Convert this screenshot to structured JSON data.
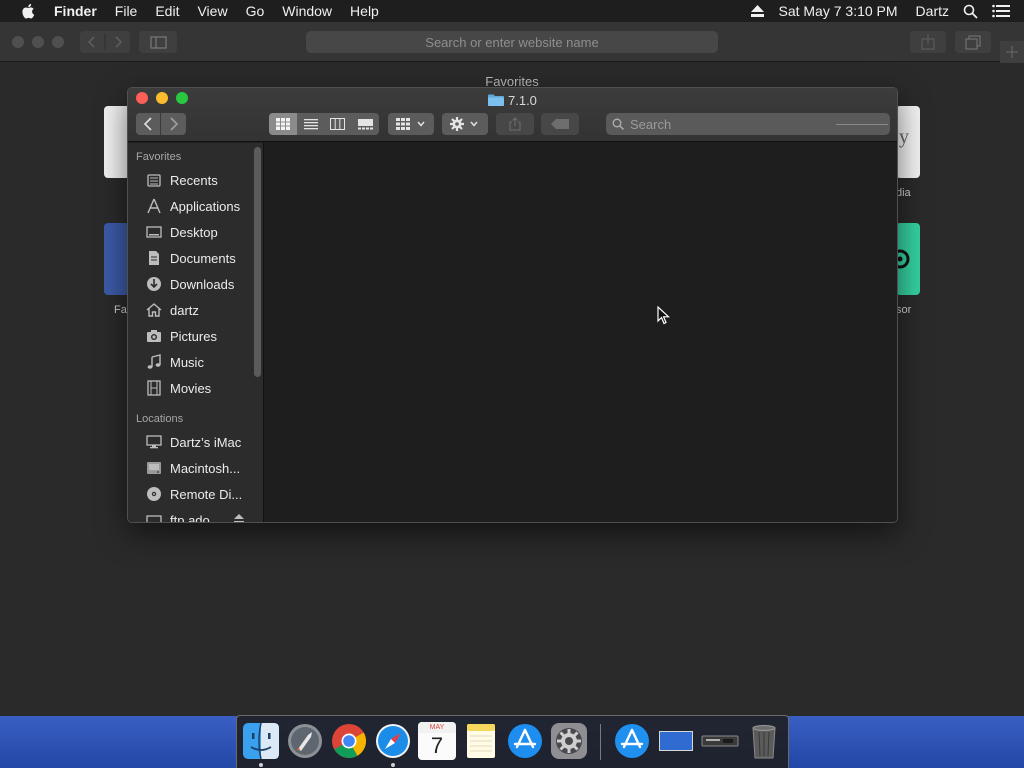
{
  "menubar": {
    "app_name": "Finder",
    "items": [
      "File",
      "Edit",
      "View",
      "Go",
      "Window",
      "Help"
    ],
    "datetime": "Sat May 7  3:10 PM",
    "user": "Dartz"
  },
  "safari": {
    "address_placeholder": "Search or enter website name",
    "favorites_heading": "Favorites",
    "partial_labels": {
      "left_bottom": "Fa",
      "right_top": "dia",
      "right_bottom": "sor"
    }
  },
  "finder": {
    "window_title": "7.1.0",
    "search_placeholder": "Search",
    "sidebar": {
      "favorites_heading": "Favorites",
      "favorites": [
        {
          "label": "Recents",
          "icon": "recents-icon"
        },
        {
          "label": "Applications",
          "icon": "applications-icon"
        },
        {
          "label": "Desktop",
          "icon": "desktop-icon"
        },
        {
          "label": "Documents",
          "icon": "documents-icon"
        },
        {
          "label": "Downloads",
          "icon": "downloads-icon"
        },
        {
          "label": "dartz",
          "icon": "home-icon"
        },
        {
          "label": "Pictures",
          "icon": "pictures-icon"
        },
        {
          "label": "Music",
          "icon": "music-icon"
        },
        {
          "label": "Movies",
          "icon": "movies-icon"
        }
      ],
      "locations_heading": "Locations",
      "locations": [
        {
          "label": "Dartz’s iMac",
          "icon": "computer-icon"
        },
        {
          "label": "Macintosh...",
          "icon": "disk-icon"
        },
        {
          "label": "Remote Di...",
          "icon": "remote-disc-icon"
        },
        {
          "label": "ftp.ado...",
          "icon": "network-volume-icon"
        }
      ]
    }
  },
  "dock": {
    "apps": [
      "Finder",
      "Launchpad",
      "Google Chrome",
      "Safari",
      "Calendar",
      "Notes",
      "App Store",
      "System Preferences",
      "Applications",
      "Desktop",
      "Device",
      "Trash"
    ],
    "calendar": {
      "month": "MAY",
      "day": "7"
    }
  }
}
